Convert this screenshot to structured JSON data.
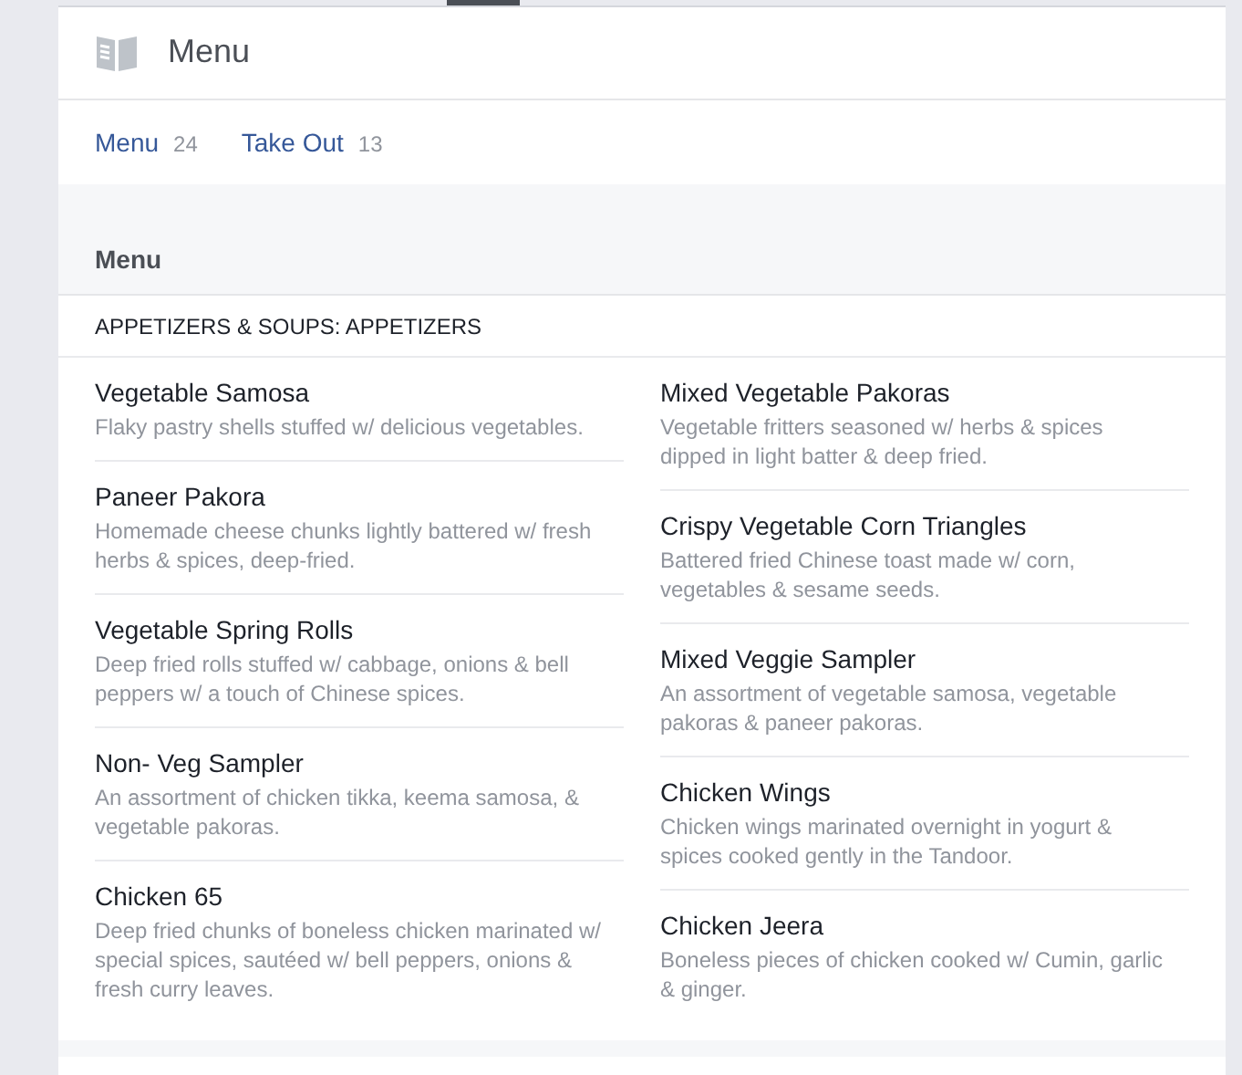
{
  "header": {
    "title": "Menu"
  },
  "tabs": [
    {
      "label": "Menu",
      "count": "24"
    },
    {
      "label": "Take Out",
      "count": "13"
    }
  ],
  "section": {
    "title": "Menu",
    "category": "APPETIZERS & SOUPS: APPETIZERS"
  },
  "columns": [
    [
      {
        "name": "Vegetable Samosa",
        "description": "Flaky pastry shells stuffed w/ delicious vegetables."
      },
      {
        "name": "Paneer Pakora",
        "description": "Homemade cheese chunks lightly battered w/ fresh herbs & spices, deep-fried."
      },
      {
        "name": "Vegetable Spring Rolls",
        "description": "Deep fried rolls stuffed w/ cabbage, onions & bell peppers w/ a touch of Chinese spices."
      },
      {
        "name": "Non- Veg Sampler",
        "description": "An assortment of chicken tikka, keema samosa, & vegetable pakoras."
      },
      {
        "name": "Chicken 65",
        "description": "Deep fried chunks of boneless chicken marinated w/ special spices, sautéed w/ bell peppers, onions & fresh curry leaves."
      }
    ],
    [
      {
        "name": "Mixed Vegetable Pakoras",
        "description": "Vegetable fritters seasoned w/ herbs & spices dipped in light batter & deep fried."
      },
      {
        "name": "Crispy Vegetable Corn Triangles",
        "description": "Battered fried Chinese toast made w/ corn, vegetables & sesame seeds."
      },
      {
        "name": "Mixed Veggie Sampler",
        "description": "An assortment of vegetable samosa, vegetable pakoras & paneer pakoras."
      },
      {
        "name": "Chicken Wings",
        "description": "Chicken wings marinated overnight in yogurt & spices cooked gently in the Tandoor."
      },
      {
        "name": "Chicken Jeera",
        "description": "Boneless pieces of chicken cooked w/ Cumin, garlic & ginger."
      }
    ]
  ]
}
